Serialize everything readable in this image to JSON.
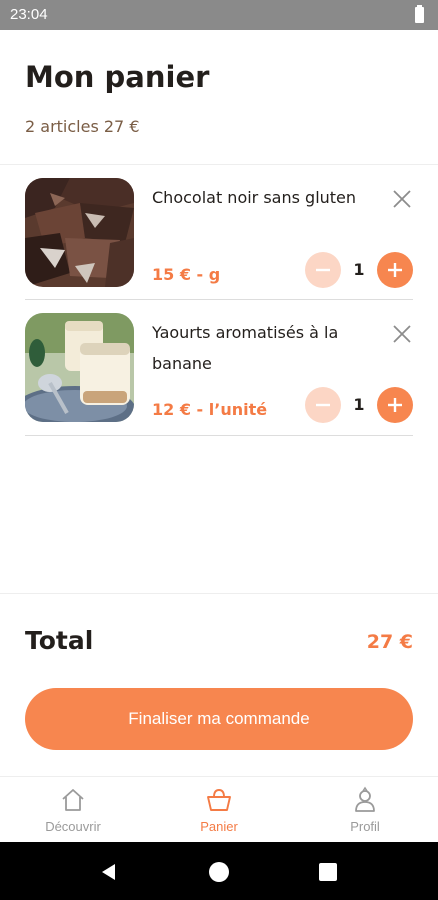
{
  "status_bar": {
    "time": "23:04"
  },
  "header": {
    "title": "Mon panier",
    "summary": "2 articles 27 €"
  },
  "cart": {
    "items": [
      {
        "name": "Chocolat noir sans gluten",
        "price": "15 € - g",
        "quantity": "1",
        "image": "dark-chocolate-pieces"
      },
      {
        "name": "Yaourts aromatisés à la banane",
        "price": "12 € - l’unité",
        "quantity": "1",
        "image": "yogurt-jars"
      }
    ]
  },
  "total": {
    "label": "Total",
    "value": "27 €"
  },
  "checkout": {
    "label": "Finaliser ma commande"
  },
  "bottom_nav": {
    "items": [
      {
        "label": "Découvrir",
        "icon": "home-icon",
        "active": false
      },
      {
        "label": "Panier",
        "icon": "basket-icon",
        "active": true
      },
      {
        "label": "Profil",
        "icon": "profile-icon",
        "active": false
      }
    ]
  },
  "colors": {
    "accent": "#f7864f",
    "accent_light": "#fcd6c5",
    "price": "#f47b45",
    "summary": "#7a5d45"
  }
}
